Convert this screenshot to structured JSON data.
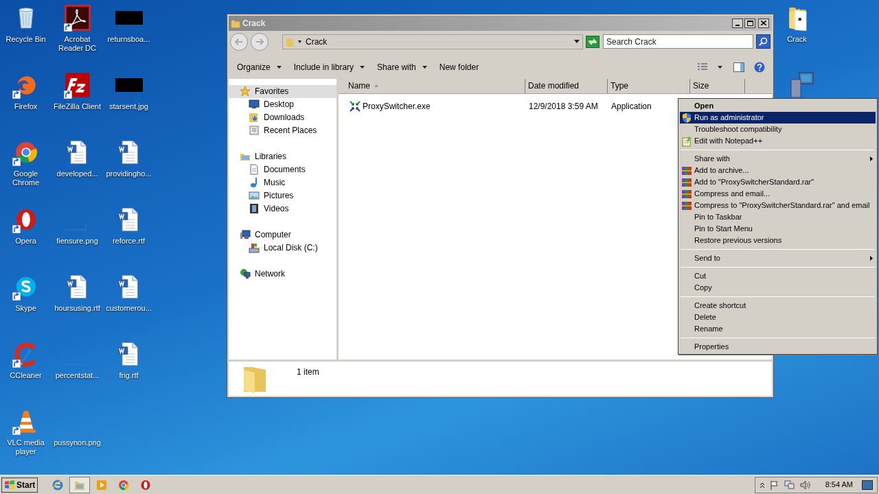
{
  "desktop": {
    "icons": [
      {
        "label": "Recycle Bin",
        "kind": "recycle",
        "shortcut": false
      },
      {
        "label": "Firefox",
        "kind": "firefox",
        "shortcut": true
      },
      {
        "label": "Google Chrome",
        "kind": "chrome",
        "shortcut": true
      },
      {
        "label": "Opera",
        "kind": "opera",
        "shortcut": true
      },
      {
        "label": "Skype",
        "kind": "skype",
        "shortcut": true
      },
      {
        "label": "CCleaner",
        "kind": "ccleaner",
        "shortcut": true
      },
      {
        "label": "VLC media player",
        "kind": "vlc",
        "shortcut": true
      },
      {
        "label": "Acrobat Reader DC",
        "kind": "acrobat",
        "shortcut": true
      },
      {
        "label": "FileZilla Client",
        "kind": "filezilla",
        "shortcut": true
      },
      {
        "label": "developed...",
        "kind": "word",
        "shortcut": false
      },
      {
        "label": "fiensure.png",
        "kind": "blank_image",
        "shortcut": false
      },
      {
        "label": "hoursusing.rtf",
        "kind": "word",
        "shortcut": false
      },
      {
        "label": "percentstat...",
        "kind": "blank_image",
        "shortcut": false
      },
      {
        "label": "pussynon.png",
        "kind": "blank_image",
        "shortcut": false
      },
      {
        "label": "returnsboa...",
        "kind": "black_image",
        "shortcut": false
      },
      {
        "label": "starsent.jpg",
        "kind": "black_image",
        "shortcut": false
      },
      {
        "label": "providingho...",
        "kind": "word",
        "shortcut": false
      },
      {
        "label": "reforce.rtf",
        "kind": "word",
        "shortcut": false
      },
      {
        "label": "customerou...",
        "kind": "word",
        "shortcut": false
      },
      {
        "label": "frig.rtf",
        "kind": "word",
        "shortcut": false
      }
    ],
    "right_icons": [
      {
        "label": "Crack",
        "kind": "folder",
        "shortcut": false
      }
    ]
  },
  "window": {
    "title": "Crack",
    "address": {
      "path": "Crack",
      "search_placeholder": "Search Crack"
    },
    "toolbar": [
      {
        "label": "Organize",
        "dropdown": true
      },
      {
        "label": "Include in library",
        "dropdown": true
      },
      {
        "label": "Share with",
        "dropdown": true
      },
      {
        "label": "New folder",
        "dropdown": false
      }
    ],
    "nav": [
      {
        "label": "Favorites",
        "kind": "star",
        "selected": true,
        "children": [
          {
            "label": "Desktop",
            "kind": "desktop",
            "selected": false
          },
          {
            "label": "Downloads",
            "kind": "downloads",
            "selected": false
          },
          {
            "label": "Recent Places",
            "kind": "recent",
            "selected": false
          }
        ]
      },
      {
        "label": "Libraries",
        "kind": "libraries",
        "selected": false,
        "children": [
          {
            "label": "Documents",
            "kind": "documents",
            "selected": false
          },
          {
            "label": "Music",
            "kind": "music",
            "selected": false
          },
          {
            "label": "Pictures",
            "kind": "pictures",
            "selected": false
          },
          {
            "label": "Videos",
            "kind": "videos",
            "selected": false
          }
        ]
      },
      {
        "label": "Computer",
        "kind": "computer",
        "selected": false,
        "children": [
          {
            "label": "Local Disk (C:)",
            "kind": "disk",
            "selected": false
          }
        ]
      },
      {
        "label": "Network",
        "kind": "network",
        "selected": false
      }
    ],
    "columns": [
      {
        "label": "Name",
        "sorted": true
      },
      {
        "label": "Date modified",
        "sorted": false
      },
      {
        "label": "Type",
        "sorted": false
      },
      {
        "label": "Size",
        "sorted": false
      }
    ],
    "rows": [
      {
        "name": "ProxySwitcher.exe",
        "date_modified": "12/9/2018 3:59 AM",
        "type": "Application"
      }
    ],
    "status": "1 item"
  },
  "context_menu": [
    {
      "kind": "item",
      "label": "Open",
      "default": true,
      "selected": false
    },
    {
      "kind": "shield",
      "label": "Run as administrator",
      "selected": true
    },
    {
      "kind": "item",
      "label": "Troubleshoot compatibility",
      "selected": false
    },
    {
      "kind": "notepad",
      "label": "Edit with Notepad++",
      "selected": false
    },
    {
      "kind": "separator"
    },
    {
      "kind": "item",
      "label": "Share with",
      "submenu": true,
      "selected": false
    },
    {
      "kind": "archive",
      "label": "Add to archive...",
      "selected": false
    },
    {
      "kind": "archive",
      "label": "Add to \"ProxySwitcherStandard.rar\"",
      "selected": false
    },
    {
      "kind": "archive",
      "label": "Compress and email...",
      "selected": false
    },
    {
      "kind": "archive",
      "label": "Compress to \"ProxySwitcherStandard.rar\" and email",
      "selected": false
    },
    {
      "kind": "item",
      "label": "Pin to Taskbar",
      "selected": false
    },
    {
      "kind": "item",
      "label": "Pin to Start Menu",
      "selected": false
    },
    {
      "kind": "item",
      "label": "Restore previous versions",
      "selected": false
    },
    {
      "kind": "separator"
    },
    {
      "kind": "item",
      "label": "Send to",
      "submenu": true,
      "selected": false
    },
    {
      "kind": "separator"
    },
    {
      "kind": "item",
      "label": "Cut",
      "selected": false
    },
    {
      "kind": "item",
      "label": "Copy",
      "selected": false
    },
    {
      "kind": "separator"
    },
    {
      "kind": "item",
      "label": "Create shortcut",
      "selected": false
    },
    {
      "kind": "item",
      "label": "Delete",
      "selected": false
    },
    {
      "kind": "item",
      "label": "Rename",
      "selected": false
    },
    {
      "kind": "separator"
    },
    {
      "kind": "item",
      "label": "Properties",
      "selected": false
    }
  ],
  "taskbar": {
    "start": "Start",
    "apps": [
      {
        "kind": "ie"
      },
      {
        "kind": "explorer",
        "selected": true
      },
      {
        "kind": "media"
      },
      {
        "kind": "chrome"
      },
      {
        "kind": "opera"
      }
    ],
    "clock": "8:54 AM"
  }
}
